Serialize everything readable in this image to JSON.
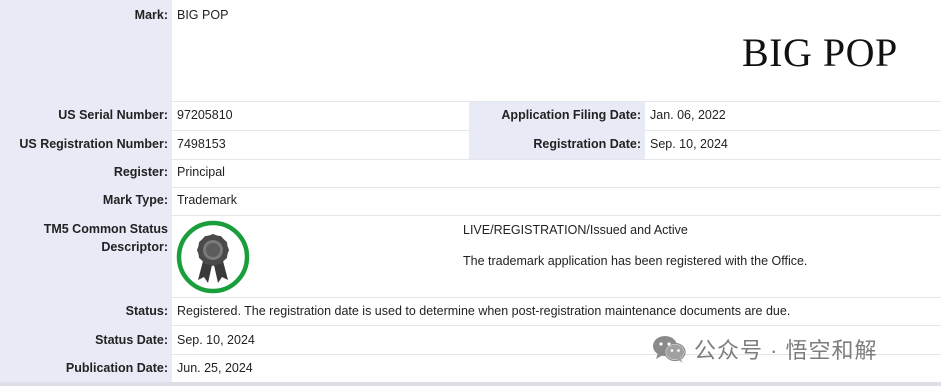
{
  "mark": {
    "label": "Mark:",
    "value": "BIG POP",
    "image_text": "BIG POP"
  },
  "serial": {
    "label": "US Serial Number:",
    "value": "97205810"
  },
  "filing_date": {
    "label": "Application Filing Date:",
    "value": "Jan. 06, 2022"
  },
  "registration_number": {
    "label": "US Registration Number:",
    "value": "7498153"
  },
  "registration_date": {
    "label": "Registration Date:",
    "value": "Sep. 10, 2024"
  },
  "register": {
    "label": "Register:",
    "value": "Principal"
  },
  "mark_type": {
    "label": "Mark Type:",
    "value": "Trademark"
  },
  "tm5": {
    "label_line1": "TM5 Common Status",
    "label_line2": "Descriptor:",
    "status_text": "LIVE/REGISTRATION/Issued and Active",
    "description": "The trademark application has been registered with the Office.",
    "icon": "registered-ribbon-icon",
    "ring_color": "#1a9e3c"
  },
  "status": {
    "label": "Status:",
    "value": "Registered. The registration date is used to determine when post-registration maintenance documents are due."
  },
  "status_date": {
    "label": "Status Date:",
    "value": "Sep. 10, 2024"
  },
  "publication_date": {
    "label": "Publication Date:",
    "value": "Jun. 25, 2024"
  },
  "watermark": {
    "text": "公众号 · 悟空和解",
    "icon": "wechat-icon"
  },
  "colors": {
    "label_bg": "#e8eaf6",
    "text": "#222222",
    "watermark": "#7d7d7d"
  }
}
